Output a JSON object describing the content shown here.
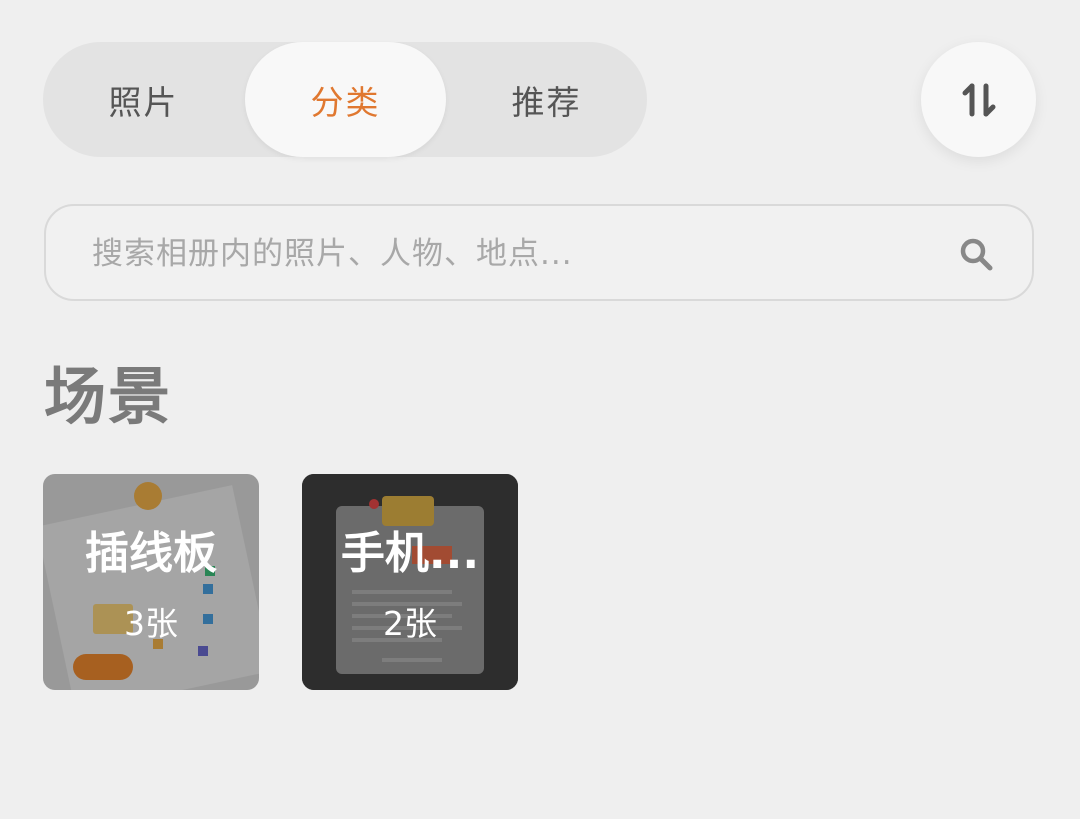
{
  "tabs": [
    {
      "label": "照片",
      "active": false
    },
    {
      "label": "分类",
      "active": true
    },
    {
      "label": "推荐",
      "active": false
    }
  ],
  "accent_color": "#e07830",
  "sort_button": {
    "icon": "sort-updown-icon"
  },
  "search": {
    "placeholder": "搜索相册内的照片、人物、地点...",
    "icon": "search-icon"
  },
  "section": {
    "title": "场景"
  },
  "albums": [
    {
      "name": "插线板",
      "count": "3张"
    },
    {
      "name": "手机...",
      "count": "2张"
    }
  ]
}
